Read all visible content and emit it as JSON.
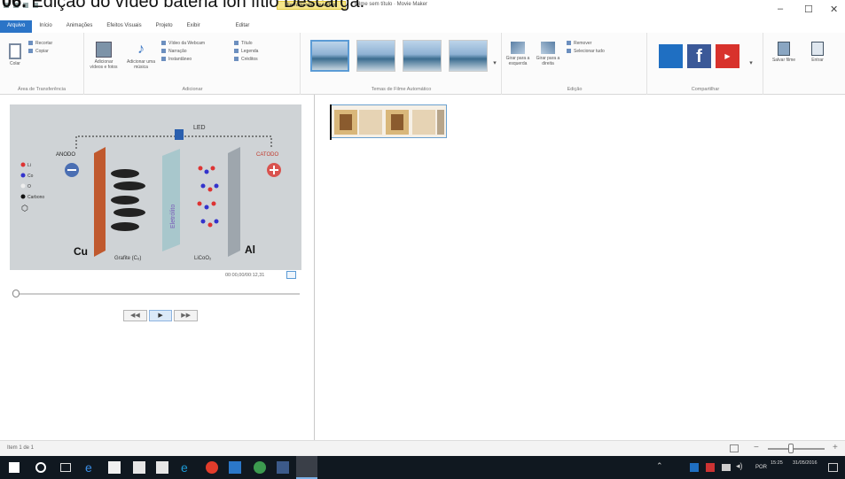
{
  "caption": {
    "prefix": "06.",
    "text": " Edição do vídeo bateria ion lítio Descarga."
  },
  "window": {
    "context_tab": "Ferramentas de Vídeo",
    "title": "Filme sem título · Movie Maker",
    "minimize": "–",
    "maximize": "☐",
    "close": "✕"
  },
  "tabs": [
    "Arquivo",
    "Início",
    "Animações",
    "Efeitos Visuais",
    "Projeto",
    "Exibir",
    "Editar"
  ],
  "ribbon": {
    "clipboard": {
      "paste": "Colar",
      "cut": "Recortar",
      "copy": "Copiar",
      "label": "Área de Transferência"
    },
    "add": {
      "add_videos": "Adicionar vídeos e fotos",
      "add_music": "Adicionar uma música",
      "list": [
        "Vídeo da Webcam",
        "Narração",
        "Instantâneo",
        "Título",
        "Legenda",
        "Créditos"
      ],
      "label": "Adicionar"
    },
    "themes": {
      "label": "Temas de Filme Automático"
    },
    "editing": {
      "rotate_left": "Girar para a esquerda",
      "rotate_right": "Girar para a direita",
      "remove": "Remover",
      "select_all": "Selecionar tudo",
      "label": "Edição"
    },
    "share": {
      "label": "Compartilhar"
    },
    "save": {
      "save_movie": "Salvar filme",
      "sign_in": "Entrar"
    }
  },
  "preview": {
    "labels": {
      "led": "LED",
      "anode": "ANODO",
      "cathode": "CATODO",
      "cu": "Cu",
      "al": "Al",
      "grafite": "Grafite (C₆)",
      "licoo2": "LiCoO₂",
      "eletrolito": "Eletrólito"
    },
    "legend": [
      "Li",
      "Co",
      "O",
      "Carbono"
    ],
    "timecode": "00:00,00/00:12,31",
    "controls": [
      "◀◀",
      "▶",
      "▶▶"
    ]
  },
  "status": {
    "left": "Item 1 de 1"
  },
  "taskbar": {
    "time": "15:25",
    "date": "31/05/2016",
    "lang": "POR"
  },
  "colors": {
    "accent": "#2b74c7",
    "context": "#f5e58a",
    "copper": "#c0592e",
    "electrolyte": "#a8c7cc",
    "taskbar": "#101820"
  }
}
